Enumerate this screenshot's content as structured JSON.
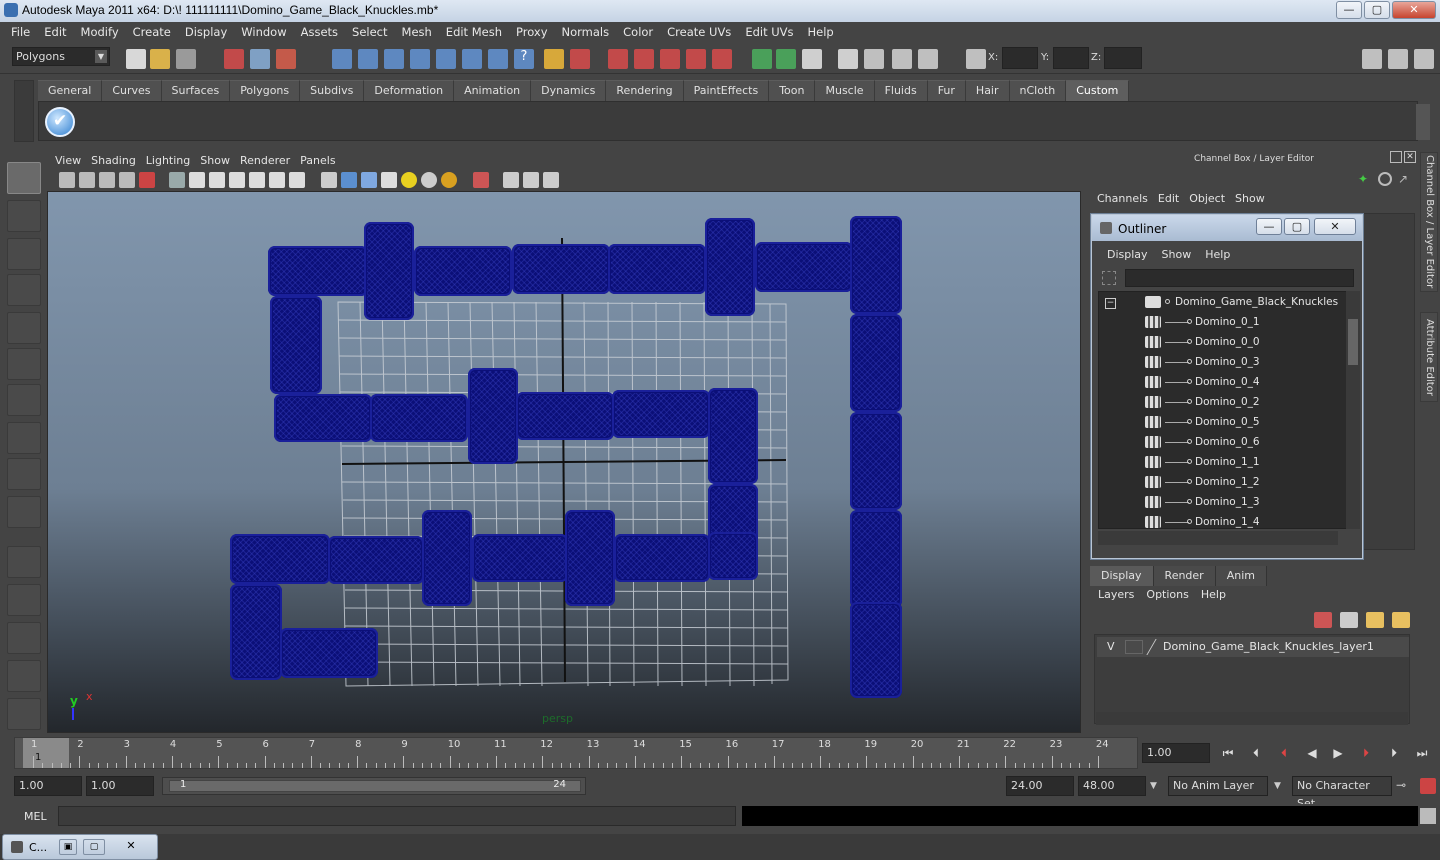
{
  "window": {
    "title": "Autodesk Maya 2011 x64: D:\\! 111111111\\Domino_Game_Black_Knuckles.mb*",
    "min": "—",
    "max": "▢",
    "close": "✕"
  },
  "menubar": [
    "File",
    "Edit",
    "Modify",
    "Create",
    "Display",
    "Window",
    "Assets",
    "Select",
    "Mesh",
    "Edit Mesh",
    "Proxy",
    "Normals",
    "Color",
    "Create UVs",
    "Edit UVs",
    "Help"
  ],
  "toolbar": {
    "mode": "Polygons",
    "x_label": "X:",
    "y_label": "Y:",
    "z_label": "Z:"
  },
  "shelf": {
    "tabs": [
      "General",
      "Curves",
      "Surfaces",
      "Polygons",
      "Subdivs",
      "Deformation",
      "Animation",
      "Dynamics",
      "Rendering",
      "PaintEffects",
      "Toon",
      "Muscle",
      "Fluids",
      "Fur",
      "Hair",
      "nCloth",
      "Custom"
    ],
    "active_tab": "Custom"
  },
  "panel": {
    "menu": [
      "View",
      "Shading",
      "Lighting",
      "Show",
      "Renderer",
      "Panels"
    ],
    "camera": "persp",
    "axis_y": "y",
    "axis_x": "x"
  },
  "channelbox": {
    "title": "Channel Box / Layer Editor",
    "menu": [
      "Channels",
      "Edit",
      "Object",
      "Show"
    ]
  },
  "outliner": {
    "title": "Outliner",
    "menu": [
      "Display",
      "Show",
      "Help"
    ],
    "root": "Domino_Game_Black_Knuckles",
    "items": [
      "Domino_0_1",
      "Domino_0_0",
      "Domino_0_3",
      "Domino_0_4",
      "Domino_0_2",
      "Domino_0_5",
      "Domino_0_6",
      "Domino_1_1",
      "Domino_1_2",
      "Domino_1_3",
      "Domino_1_4"
    ]
  },
  "layers": {
    "tabs": [
      "Display",
      "Render",
      "Anim"
    ],
    "active_tab": "Display",
    "menu": [
      "Layers",
      "Options",
      "Help"
    ],
    "visible_flag": "V",
    "layer_name": "Domino_Game_Black_Knuckles_layer1"
  },
  "side_tabs": {
    "channel_box": "Channel Box / Layer Editor",
    "attribute_editor": "Attribute Editor"
  },
  "timeline": {
    "ticks": [
      "1",
      "2",
      "3",
      "4",
      "5",
      "6",
      "7",
      "8",
      "9",
      "10",
      "11",
      "12",
      "13",
      "14",
      "15",
      "16",
      "17",
      "18",
      "19",
      "20",
      "21",
      "22",
      "23",
      "24"
    ],
    "current_frame_marker": "1",
    "current_time": "1.00"
  },
  "range": {
    "start_time": "1.00",
    "playback_start": "1.00",
    "range_start_label": "1",
    "range_end_label": "24",
    "playback_end": "24.00",
    "end_time": "48.00",
    "anim_layer": "No Anim Layer",
    "character_set": "No Character Set"
  },
  "command": {
    "label": "MEL"
  },
  "taskbar": {
    "item": "C..."
  },
  "colors": {
    "domino": "#0b0f78",
    "ui_bg": "#444444"
  }
}
